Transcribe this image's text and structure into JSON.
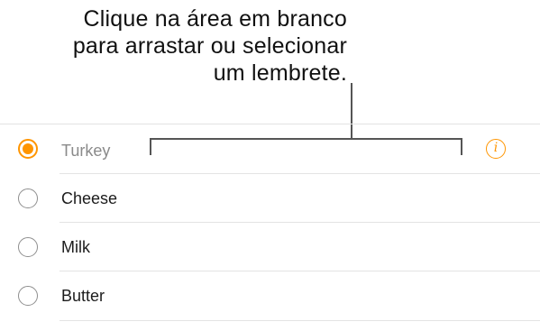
{
  "callout": {
    "line1": "Clique na área em branco",
    "line2": "para arrastar ou selecionar",
    "line3": "um lembrete."
  },
  "reminders": [
    {
      "label": "Turkey",
      "checked": true
    },
    {
      "label": "Cheese",
      "checked": false
    },
    {
      "label": "Milk",
      "checked": false
    },
    {
      "label": "Butter",
      "checked": false
    }
  ],
  "info_glyph": "i",
  "colors": {
    "accent": "#ff9500",
    "text": "#1c1c1c",
    "selected_text": "#8a8a8a",
    "divider": "#e3e3e3",
    "bracket": "#555555"
  },
  "icons": {
    "selected_radio": "radio-checked-icon",
    "unselected_radio": "radio-empty-icon",
    "info": "info-icon"
  }
}
